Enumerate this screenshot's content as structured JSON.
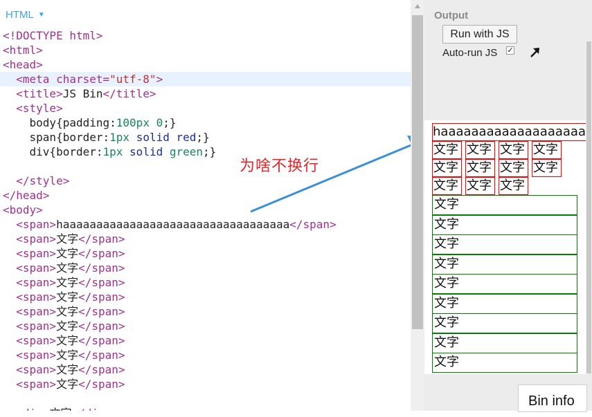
{
  "editor": {
    "tab_label": "HTML",
    "lines": [
      {
        "segments": [
          [
            "tag",
            "<!DOCTYPE html>"
          ]
        ]
      },
      {
        "segments": [
          [
            "tag",
            "<html>"
          ]
        ]
      },
      {
        "segments": [
          [
            "tag",
            "<head>"
          ]
        ]
      },
      {
        "segments": [
          [
            "txt",
            "  "
          ],
          [
            "tag",
            "<meta "
          ],
          [
            "attr",
            "charset="
          ],
          [
            "str",
            "\"utf-8\""
          ],
          [
            "tag",
            ">"
          ]
        ],
        "highlight": true
      },
      {
        "segments": [
          [
            "txt",
            "  "
          ],
          [
            "tag",
            "<title>"
          ],
          [
            "txt",
            "JS Bin"
          ],
          [
            "tag",
            "</title>"
          ]
        ]
      },
      {
        "segments": [
          [
            "txt",
            "  "
          ],
          [
            "tag",
            "<style>"
          ]
        ]
      },
      {
        "segments": [
          [
            "txt",
            "    body{"
          ],
          [
            "prop",
            "padding"
          ],
          [
            "txt",
            ":"
          ],
          [
            "num",
            "100px 0"
          ],
          [
            "txt",
            ";}"
          ]
        ]
      },
      {
        "segments": [
          [
            "txt",
            "    span{"
          ],
          [
            "prop",
            "border"
          ],
          [
            "txt",
            ":"
          ],
          [
            "num",
            "1px"
          ],
          [
            "txt",
            " "
          ],
          [
            "kw",
            "solid red"
          ],
          [
            "txt",
            ";}"
          ]
        ]
      },
      {
        "segments": [
          [
            "txt",
            "    div{"
          ],
          [
            "prop",
            "border"
          ],
          [
            "txt",
            ":"
          ],
          [
            "num",
            "1px"
          ],
          [
            "txt",
            " "
          ],
          [
            "kw",
            "solid"
          ],
          [
            "txt",
            " "
          ],
          [
            "col",
            "green"
          ],
          [
            "txt",
            ";}"
          ]
        ]
      },
      {
        "segments": [
          [
            "txt",
            ""
          ]
        ]
      },
      {
        "segments": [
          [
            "txt",
            "  "
          ],
          [
            "tag",
            "</style>"
          ]
        ]
      },
      {
        "segments": [
          [
            "tag",
            "</head>"
          ]
        ]
      },
      {
        "segments": [
          [
            "tag",
            "<body>"
          ]
        ]
      },
      {
        "segments": [
          [
            "txt",
            "  "
          ],
          [
            "tag",
            "<span>"
          ],
          [
            "txt",
            "haaaaaaaaaaaaaaaaaaaaaaaaaaaaaaaaaa"
          ],
          [
            "tag",
            "</span>"
          ]
        ]
      },
      {
        "segments": [
          [
            "txt",
            "  "
          ],
          [
            "tag",
            "<span>"
          ],
          [
            "txt",
            "文字"
          ],
          [
            "tag",
            "</span>"
          ]
        ]
      },
      {
        "segments": [
          [
            "txt",
            "  "
          ],
          [
            "tag",
            "<span>"
          ],
          [
            "txt",
            "文字"
          ],
          [
            "tag",
            "</span>"
          ]
        ]
      },
      {
        "segments": [
          [
            "txt",
            "  "
          ],
          [
            "tag",
            "<span>"
          ],
          [
            "txt",
            "文字"
          ],
          [
            "tag",
            "</span>"
          ]
        ]
      },
      {
        "segments": [
          [
            "txt",
            "  "
          ],
          [
            "tag",
            "<span>"
          ],
          [
            "txt",
            "文字"
          ],
          [
            "tag",
            "</span>"
          ]
        ]
      },
      {
        "segments": [
          [
            "txt",
            "  "
          ],
          [
            "tag",
            "<span>"
          ],
          [
            "txt",
            "文字"
          ],
          [
            "tag",
            "</span>"
          ]
        ]
      },
      {
        "segments": [
          [
            "txt",
            "  "
          ],
          [
            "tag",
            "<span>"
          ],
          [
            "txt",
            "文字"
          ],
          [
            "tag",
            "</span>"
          ]
        ]
      },
      {
        "segments": [
          [
            "txt",
            "  "
          ],
          [
            "tag",
            "<span>"
          ],
          [
            "txt",
            "文字"
          ],
          [
            "tag",
            "</span>"
          ]
        ]
      },
      {
        "segments": [
          [
            "txt",
            "  "
          ],
          [
            "tag",
            "<span>"
          ],
          [
            "txt",
            "文字"
          ],
          [
            "tag",
            "</span>"
          ]
        ]
      },
      {
        "segments": [
          [
            "txt",
            "  "
          ],
          [
            "tag",
            "<span>"
          ],
          [
            "txt",
            "文字"
          ],
          [
            "tag",
            "</span>"
          ]
        ]
      },
      {
        "segments": [
          [
            "txt",
            "  "
          ],
          [
            "tag",
            "<span>"
          ],
          [
            "txt",
            "文字"
          ],
          [
            "tag",
            "</span>"
          ]
        ]
      },
      {
        "segments": [
          [
            "txt",
            "  "
          ],
          [
            "tag",
            "<span>"
          ],
          [
            "txt",
            "文字"
          ],
          [
            "tag",
            "</span>"
          ]
        ]
      },
      {
        "segments": [
          [
            "txt",
            ""
          ]
        ]
      },
      {
        "segments": [
          [
            "txt",
            "  "
          ],
          [
            "tag",
            "<div>"
          ],
          [
            "txt",
            "文字"
          ],
          [
            "tag",
            "</div>"
          ]
        ]
      }
    ]
  },
  "annotation": {
    "text": "为啥不换行",
    "color": "#e0262b",
    "arrow_color": "#3a8fd9"
  },
  "output": {
    "title": "Output",
    "run_button": "Run with JS",
    "autorun_label": "Auto-run JS",
    "autorun_checked": true,
    "bin_info": "Bin info",
    "preview": {
      "long_span": "haaaaaaaaaaaaaaaaaaaaaaaaaaaaaaaaaa",
      "spans": [
        "文字",
        "文字",
        "文字",
        "文字",
        "文字",
        "文字",
        "文字",
        "文字",
        "文字",
        "文字",
        "文字"
      ],
      "divs": [
        "文字",
        "文字",
        "文字",
        "文字",
        "文字",
        "文字",
        "文字",
        "文字",
        "文字"
      ]
    }
  }
}
